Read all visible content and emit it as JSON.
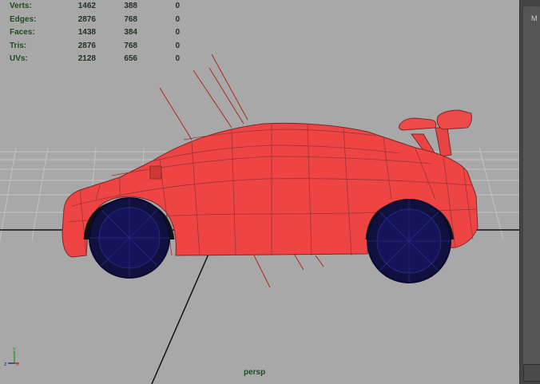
{
  "hud": {
    "rows": [
      {
        "label": "Verts:",
        "v1": "1462",
        "v2": "388",
        "v3": "0"
      },
      {
        "label": "Edges:",
        "v1": "2876",
        "v2": "768",
        "v3": "0"
      },
      {
        "label": "Faces:",
        "v1": "1438",
        "v2": "384",
        "v3": "0"
      },
      {
        "label": "Tris:",
        "v1": "2876",
        "v2": "768",
        "v3": "0"
      },
      {
        "label": "UVs:",
        "v1": "2128",
        "v2": "656",
        "v3": "0"
      }
    ]
  },
  "viewport": {
    "camera": "persp",
    "axis": {
      "y": "y",
      "x": "x",
      "z": "z"
    }
  },
  "right_panel": {
    "tab_text": "M"
  },
  "colors": {
    "background": "#a8a8a8",
    "grid": "#bcbcbc",
    "car_body": "#ee4444",
    "wireframe": "#7a2a2a",
    "wheels": "#14145a",
    "hud_text": "#1f4d1f"
  },
  "icons": [
    "axis-gizmo-icon"
  ]
}
